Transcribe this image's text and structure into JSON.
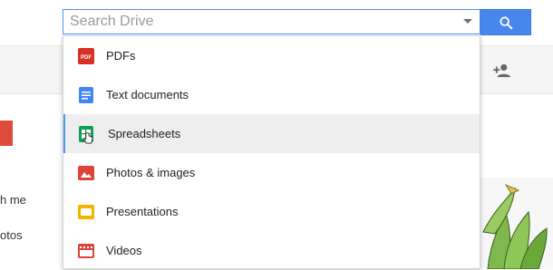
{
  "search": {
    "placeholder": "Search Drive"
  },
  "dropdown": {
    "items": [
      {
        "label": "PDFs",
        "icon": "pdf-icon",
        "color": "#d93025"
      },
      {
        "label": "Text documents",
        "icon": "document-icon",
        "color": "#4285f4"
      },
      {
        "label": "Spreadsheets",
        "icon": "spreadsheet-icon",
        "color": "#0f9d58",
        "state": "hovered"
      },
      {
        "label": "Photos & images",
        "icon": "image-icon",
        "color": "#db4437"
      },
      {
        "label": "Presentations",
        "icon": "presentation-icon",
        "color": "#f4b400"
      },
      {
        "label": "Videos",
        "icon": "video-icon",
        "color": "#db4437"
      }
    ]
  },
  "sidebar": {
    "items": [
      "h me",
      "otos"
    ]
  },
  "colors": {
    "accent": "#4787ed",
    "new_button": "#dd4b39"
  }
}
